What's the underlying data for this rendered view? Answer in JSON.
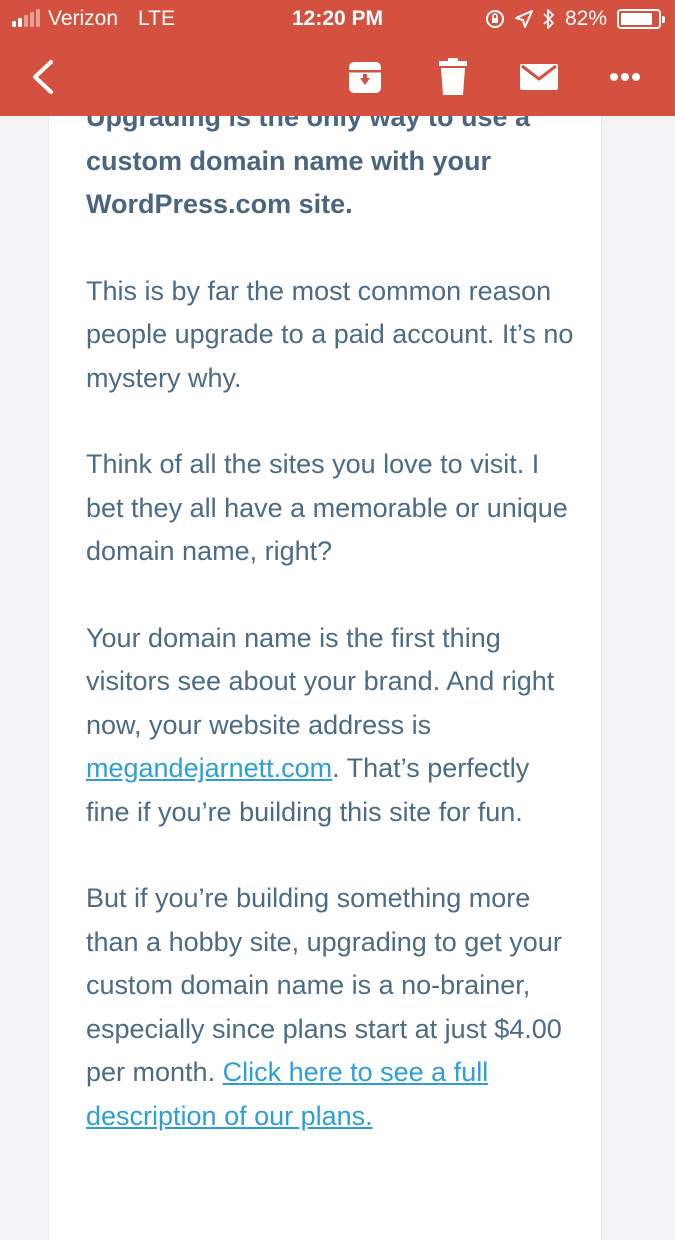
{
  "status_bar": {
    "carrier": "Verizon",
    "network": "LTE",
    "time": "12:20 PM",
    "battery_percent": "82%",
    "signal_bars_full": 2,
    "signal_bars_total": 5,
    "battery_level": 0.82
  },
  "toolbar": {
    "color": "#d4513f",
    "icons": [
      "back-chevron-icon",
      "archive-icon",
      "trash-icon",
      "mail-icon",
      "more-icon"
    ]
  },
  "email": {
    "heading": "Upgrading is the only way to use a custom domain name with your WordPress.com site.",
    "p1": "This is by far the most common reason people upgrade to a paid account. It’s no mystery why.",
    "p2": "Think of all the sites you love to visit. I bet they all have a memorable or unique domain name, right?",
    "p3_before": "Your domain name is the first thing visitors see about your brand. And right now, your website address is ",
    "p3_link": "megandejarnett.com",
    "p3_after": ". That’s perfectly fine if you’re building this site for fun.",
    "p4_before": "But if you’re building something more than a hobby site, upgrading to get your custom domain name is a no-brainer, especially since plans start at just $4.00 per month. ",
    "p4_link": "Click here to see a full description of our plans."
  }
}
